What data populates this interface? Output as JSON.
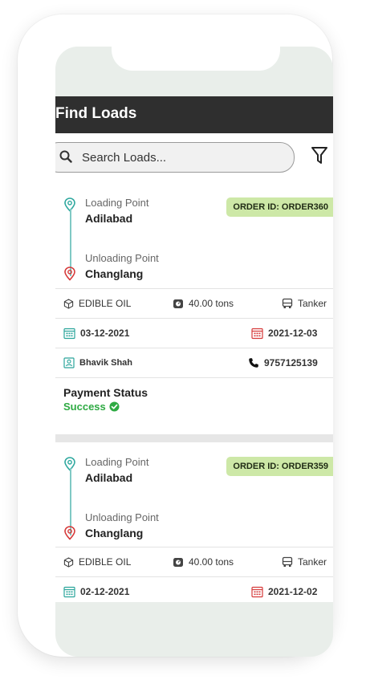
{
  "app": {
    "title": "Find Loads"
  },
  "search": {
    "placeholder": "Search Loads..."
  },
  "labels": {
    "loading_point": "Loading Point",
    "unloading_point": "Unloading Point",
    "payment_status": "Payment Status"
  },
  "orders": [
    {
      "order_id": "ORDER ID: ORDER360",
      "loading_point": "Adilabad",
      "unloading_point": "Changlang",
      "material": "EDIBLE OIL",
      "weight": "40.00 tons",
      "vehicle": "Tanker",
      "date_from": "03-12-2021",
      "date_to": "2021-12-03",
      "contact_name": "Bhavik Shah",
      "phone": "9757125139",
      "payment_status": "Success"
    },
    {
      "order_id": "ORDER ID: ORDER359",
      "loading_point": "Adilabad",
      "unloading_point": "Changlang",
      "material": "EDIBLE OIL",
      "weight": "40.00 tons",
      "vehicle": "Tanker",
      "date_from": "02-12-2021",
      "date_to": "2021-12-02"
    }
  ],
  "colors": {
    "header_bg": "#2f2f2f",
    "badge_bg": "#cde8a7",
    "success": "#2eaa43",
    "loading_pin": "#2fa89f",
    "unloading_pin": "#d63a3a",
    "date_icon": "#2aa59b",
    "date_icon_end": "#d63a3a"
  },
  "icons": {
    "search": "search-icon",
    "filter": "filter-icon",
    "loading_pin": "location-pin-icon",
    "unloading_pin": "location-pin-icon",
    "material": "box-icon",
    "weight": "weight-icon",
    "vehicle": "truck-icon",
    "date": "calendar-icon",
    "contact": "contact-card-icon",
    "phone": "phone-icon",
    "success": "check-circle-icon"
  }
}
